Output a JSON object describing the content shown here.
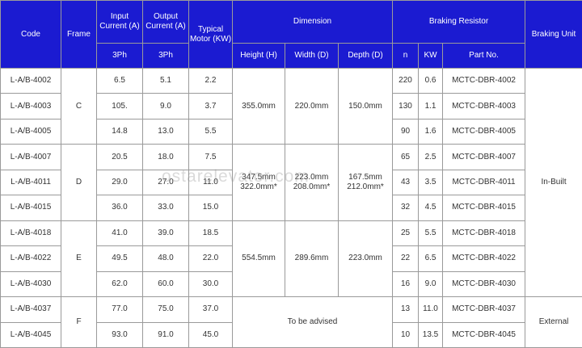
{
  "headers": {
    "code": "Code",
    "frame": "Frame",
    "input_current": "Input Current (A)",
    "output_current": "Output Current (A)",
    "typical_motor": "Typical Motor (KW)",
    "dimension": "Dimension",
    "braking_resistor": "Braking Resistor",
    "braking_unit": "Braking Unit",
    "input_phase": "3Ph",
    "output_phase": "3Ph",
    "height": "Height (H)",
    "width": "Width (D)",
    "depth": "Depth (D)",
    "n": "n",
    "kw": "KW",
    "part_no": "Part No."
  },
  "rows": [
    {
      "code": "L-A/B-4002",
      "input": "6.5",
      "output": "5.1",
      "motor": "2.2",
      "n": "220",
      "kw": "0.6",
      "part": "MCTC-DBR-4002"
    },
    {
      "code": "L-A/B-4003",
      "input": "105.",
      "output": "9.0",
      "motor": "3.7",
      "n": "130",
      "kw": "1.1",
      "part": "MCTC-DBR-4003"
    },
    {
      "code": "L-A/B-4005",
      "input": "14.8",
      "output": "13.0",
      "motor": "5.5",
      "n": "90",
      "kw": "1.6",
      "part": "MCTC-DBR-4005"
    },
    {
      "code": "L-A/B-4007",
      "input": "20.5",
      "output": "18.0",
      "motor": "7.5",
      "n": "65",
      "kw": "2.5",
      "part": "MCTC-DBR-4007"
    },
    {
      "code": "L-A/B-4011",
      "input": "29.0",
      "output": "27.0",
      "motor": "11.0",
      "n": "43",
      "kw": "3.5",
      "part": "MCTC-DBR-4011"
    },
    {
      "code": "L-A/B-4015",
      "input": "36.0",
      "output": "33.0",
      "motor": "15.0",
      "n": "32",
      "kw": "4.5",
      "part": "MCTC-DBR-4015"
    },
    {
      "code": "L-A/B-4018",
      "input": "41.0",
      "output": "39.0",
      "motor": "18.5",
      "n": "25",
      "kw": "5.5",
      "part": "MCTC-DBR-4018"
    },
    {
      "code": "L-A/B-4022",
      "input": "49.5",
      "output": "48.0",
      "motor": "22.0",
      "n": "22",
      "kw": "6.5",
      "part": "MCTC-DBR-4022"
    },
    {
      "code": "L-A/B-4030",
      "input": "62.0",
      "output": "60.0",
      "motor": "30.0",
      "n": "16",
      "kw": "9.0",
      "part": "MCTC-DBR-4030"
    },
    {
      "code": "L-A/B-4037",
      "input": "77.0",
      "output": "75.0",
      "motor": "37.0",
      "n": "13",
      "kw": "11.0",
      "part": "MCTC-DBR-4037"
    },
    {
      "code": "L-A/B-4045",
      "input": "93.0",
      "output": "91.0",
      "motor": "45.0",
      "n": "10",
      "kw": "13.5",
      "part": "MCTC-DBR-4045"
    }
  ],
  "frames": {
    "c": "C",
    "d": "D",
    "e": "E",
    "f": "F"
  },
  "dims": {
    "c": {
      "h": "355.0mm",
      "w": "220.0mm",
      "d": "150.0mm"
    },
    "d": {
      "h1": "347.5mm",
      "h2": "322.0mm*",
      "w1": "223.0mm",
      "w2": "208.0mm*",
      "d1": "167.5mm",
      "d2": "212.0mm*"
    },
    "e": {
      "h": "554.5mm",
      "w": "289.6mm",
      "d": "223.0mm"
    },
    "f": {
      "note": "To be advised"
    }
  },
  "braking_unit": {
    "builtin": "In-Built",
    "external": "External"
  },
  "watermark": "ostarelevator.com",
  "colors": {
    "header_bg": "#1b1bd1",
    "header_text": "#ffffff",
    "border": "#9a9a9a",
    "cell_text": "#333333"
  }
}
